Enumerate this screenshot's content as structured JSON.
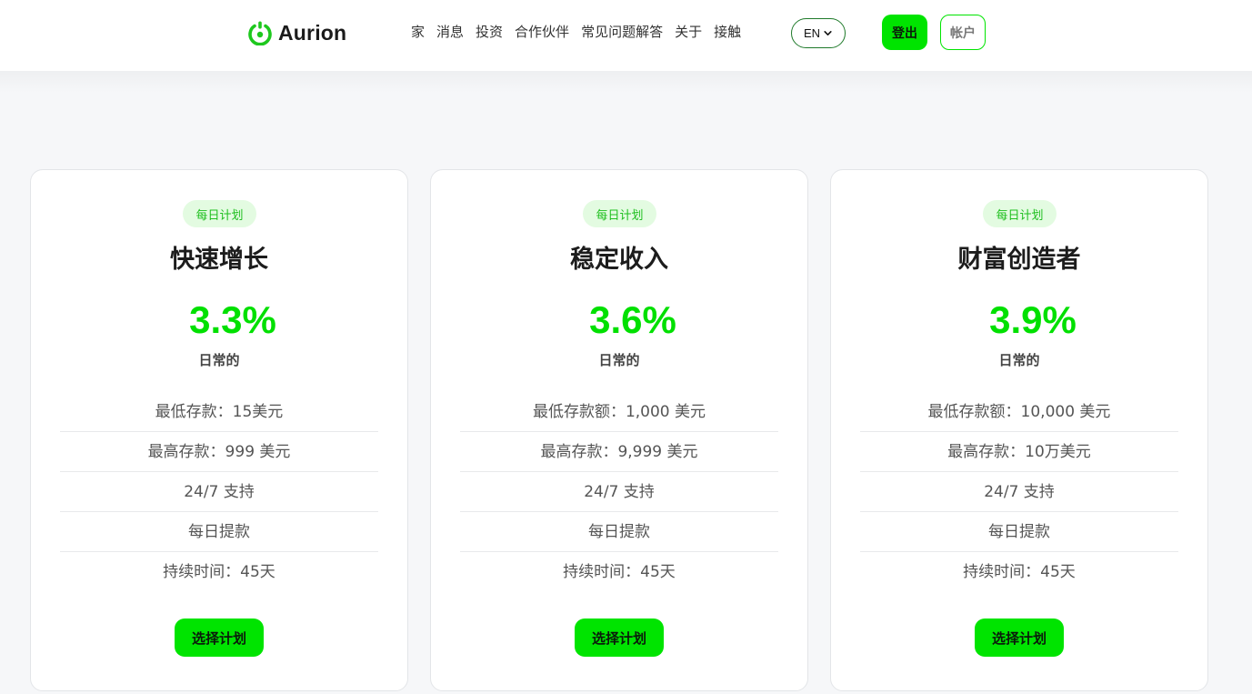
{
  "header": {
    "brand": "Aurion",
    "nav": [
      "家",
      "消息",
      "投资",
      "合作伙伴",
      "常见问题解答",
      "关于",
      "接触"
    ],
    "language": "EN",
    "login_label": "登出",
    "account_label": "帐户",
    "accent_color": "#00e400"
  },
  "plans": [
    {
      "badge": "每日计划",
      "name": "快速增长",
      "rate": "3.3%",
      "rate_label": "日常的",
      "features": [
        "最低存款：15美元",
        "最高存款：999 美元",
        "24/7 支持",
        "每日提款",
        "持续时间：45天"
      ],
      "button": "选择计划"
    },
    {
      "badge": "每日计划",
      "name": "稳定收入",
      "rate": "3.6%",
      "rate_label": "日常的",
      "features": [
        "最低存款额：1,000 美元",
        "最高存款：9,999 美元",
        "24/7 支持",
        "每日提款",
        "持续时间：45天"
      ],
      "button": "选择计划"
    },
    {
      "badge": "每日计划",
      "name": "财富创造者",
      "rate": "3.9%",
      "rate_label": "日常的",
      "features": [
        "最低存款额：10,000 美元",
        "最高存款：10万美元",
        "24/7 支持",
        "每日提款",
        "持续时间：45天"
      ],
      "button": "选择计划"
    }
  ]
}
